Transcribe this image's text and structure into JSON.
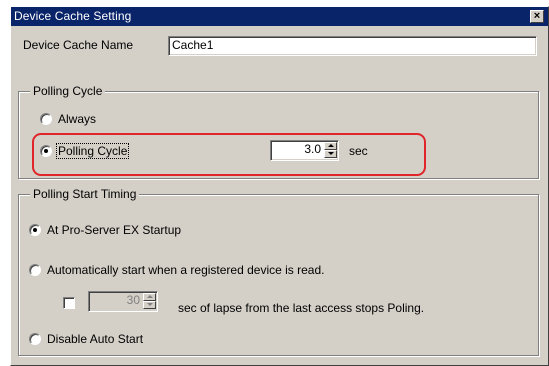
{
  "window": {
    "title": "Device Cache Setting",
    "close_label": "×"
  },
  "cache_name": {
    "label": "Device Cache Name",
    "value": "Cache1"
  },
  "polling_cycle_group": {
    "legend": "Polling Cycle",
    "options": [
      {
        "label": "Always",
        "selected": false
      },
      {
        "label": "Polling Cycle",
        "selected": true
      }
    ],
    "interval_value": "3.0",
    "interval_unit": "sec",
    "highlight_color": "#e0252b"
  },
  "polling_start_group": {
    "legend": "Polling Start Timing",
    "options": [
      {
        "label": "At Pro-Server EX Startup",
        "selected": true
      },
      {
        "label": "Automatically start when a registered device is read.",
        "selected": false
      },
      {
        "label": "Disable Auto Start",
        "selected": false
      }
    ],
    "lapse_checkbox_checked": false,
    "lapse_value": "30",
    "lapse_text": "sec of lapse from the last access stops Poling."
  }
}
